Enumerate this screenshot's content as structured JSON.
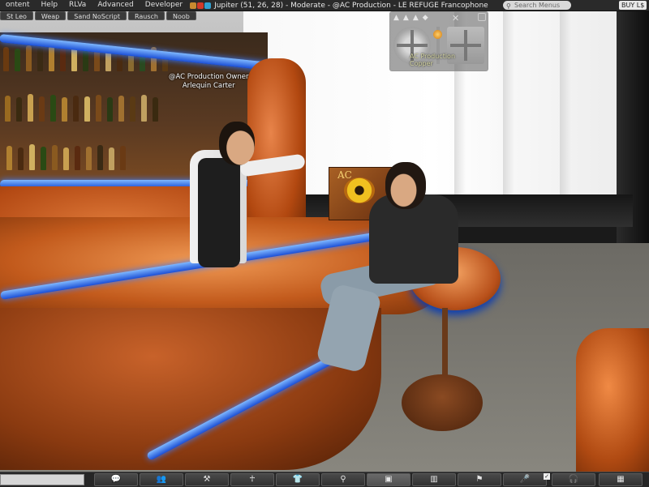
{
  "menubar": {
    "items": [
      "ontent",
      "Help",
      "RLVa",
      "Advanced",
      "Developer"
    ],
    "location": "Jupiter (51, 26, 28) - Moderate - @AC Production - LE REFUGE Francophone",
    "search_placeholder": "Search Menus",
    "buy_label": "BUY L$"
  },
  "favorites": [
    "St Leo",
    "Weap",
    "Sand NoScript",
    "Rausch",
    "Noob"
  ],
  "nametag": {
    "group": "@AC Production Owner",
    "name": "Arlequin Carter"
  },
  "camera_floater": {
    "overlay_line1": "AC Production",
    "overlay_line2": "Copper"
  },
  "sign": {
    "text": "AC"
  },
  "toolbar": {
    "buttons": [
      {
        "name": "chat",
        "icon": "speech-bubble-icon"
      },
      {
        "name": "people",
        "icon": "people-icon"
      },
      {
        "name": "build",
        "icon": "build-icon"
      },
      {
        "name": "avatar",
        "icon": "avatar-icon"
      },
      {
        "name": "appearance",
        "icon": "shirt-icon"
      },
      {
        "name": "search",
        "icon": "search-icon"
      },
      {
        "name": "snapshot",
        "icon": "camera-icon",
        "active": true
      },
      {
        "name": "inventory",
        "icon": "inventory-icon"
      },
      {
        "name": "move",
        "icon": "walk-icon"
      },
      {
        "name": "voice",
        "icon": "microphone-icon"
      },
      {
        "name": "sound",
        "icon": "headphones-icon"
      },
      {
        "name": "map",
        "icon": "map-icon"
      }
    ]
  },
  "colors": {
    "menubar_bg": "#2a2a2a",
    "neon_blue": "#1b4fd6",
    "wood_orange": "#c25a1c"
  }
}
